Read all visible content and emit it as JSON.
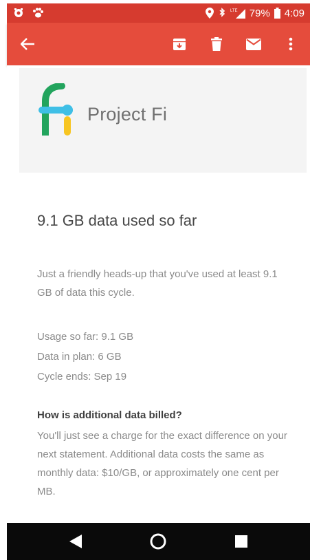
{
  "status_bar": {
    "battery": "79%",
    "time": "4:09",
    "network": "LTE",
    "icons": [
      "notification-icon",
      "paw-icon",
      "location-icon",
      "bluetooth-icon",
      "signal-icon",
      "battery-icon"
    ]
  },
  "app_bar": {
    "back_icon": "arrow-left-icon",
    "actions": [
      "archive-icon",
      "delete-icon",
      "mark-unread-icon",
      "more-icon"
    ]
  },
  "email": {
    "brand_name": "Project Fi",
    "headline": "9.1 GB data used so far",
    "intro": "Just a friendly heads-up that you've used at least 9.1 GB of data this cycle.",
    "stats": {
      "usage": "Usage so far: 9.1 GB",
      "plan": "Data in plan: 6 GB",
      "cycle": "Cycle ends: Sep 19"
    },
    "faq_title": "How is additional data billed?",
    "faq_body": "You'll just see a charge for the exact difference on your next statement. Additional data costs the same as monthly data: $10/GB, or approximately one cent per MB."
  },
  "nav_bar": {
    "icons": [
      "back-triangle-icon",
      "home-circle-icon",
      "recents-square-icon"
    ]
  },
  "colors": {
    "status_bar": "#d63b2f",
    "app_bar": "#e54c3c",
    "logo_green": "#22a45d",
    "logo_blue": "#3fbfe6",
    "logo_yellow": "#f7c521",
    "nav_bar": "#0a0a0a"
  }
}
